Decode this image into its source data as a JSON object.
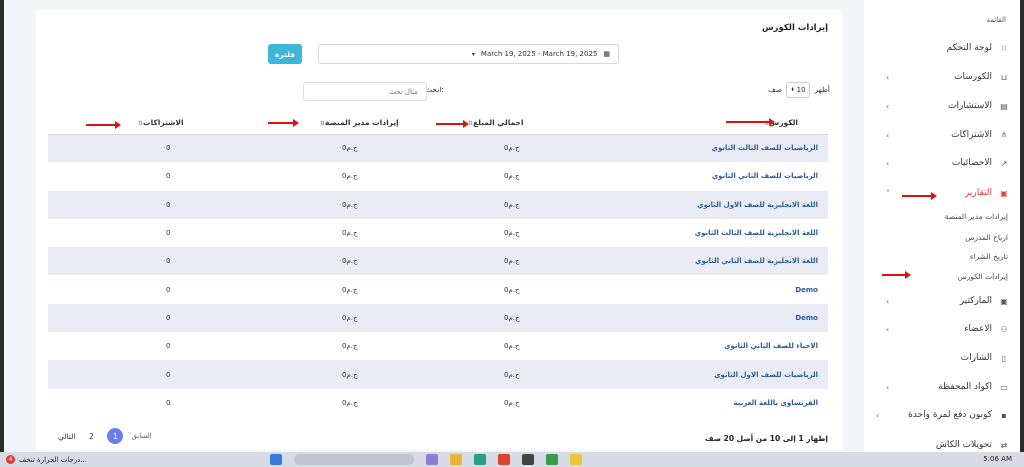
{
  "sidebar": {
    "heading": "القائمة",
    "items": [
      {
        "label": "لوحة التحكم",
        "icon": "grid-icon",
        "chevron": false
      },
      {
        "label": "الكورسات",
        "icon": "basket-icon",
        "chevron": true
      },
      {
        "label": "الاستشارات",
        "icon": "document-icon",
        "chevron": true
      },
      {
        "label": "الاشتراكات",
        "icon": "hierarchy-icon",
        "chevron": true
      },
      {
        "label": "الاحصائيات",
        "icon": "trend-icon",
        "chevron": true
      },
      {
        "label": "التقارير",
        "icon": "archive-icon",
        "chevron": true
      },
      {
        "label": "الماركتير",
        "icon": "archive-icon",
        "chevron": true
      },
      {
        "label": "الاعضاء",
        "icon": "users-icon",
        "chevron": true
      },
      {
        "label": "الشارات",
        "icon": "phone-icon",
        "chevron": false
      },
      {
        "label": "اكواد المحفظة",
        "icon": "wallet-icon",
        "chevron": true
      },
      {
        "label": "كوبون دفع لمرة واحدة",
        "icon": "coupon-icon",
        "chevron": true
      },
      {
        "label": "تحويلات الكاش",
        "icon": "transfer-icon",
        "chevron": false
      }
    ],
    "reports_sub": [
      "إيرادات مدير المنصة",
      "ارباح المدرس",
      "تاريخ الشراء",
      "إيرادات الكورس"
    ]
  },
  "card": {
    "title": "إيرادات الكورس",
    "date_range": "March 19, 2025 - March 19, 2025",
    "filter_label": "فلترة",
    "show_label": "أظهر",
    "page_size": "10",
    "rows_label": "صف",
    "search_label": "ابحث:",
    "search_placeholder": "مثال بحث"
  },
  "table": {
    "headers": {
      "course": "الكورس",
      "total": "اجمالي المبلغ",
      "platform": "إيرادات مدير المنصة",
      "subs": "الاشتراكات"
    },
    "rows": [
      {
        "course": "الرياضيات للصف الثالث الثانوي",
        "total": "0ج.م",
        "platform": "0ج.م",
        "subs": "0"
      },
      {
        "course": "الرياضيات للصف الثاني الثانوي",
        "total": "0ج.م",
        "platform": "0ج.م",
        "subs": "0"
      },
      {
        "course": "اللغة الانجليزية للصف الاول الثانوي",
        "total": "0ج.م",
        "platform": "0ج.م",
        "subs": "0"
      },
      {
        "course": "اللغة الانجليزية للصف الثالث الثانوي",
        "total": "0ج.م",
        "platform": "0ج.م",
        "subs": "0"
      },
      {
        "course": "اللغة الانجليزية للصف الثاني الثانوي",
        "total": "0ج.م",
        "platform": "0ج.م",
        "subs": "0"
      },
      {
        "course": "Demo",
        "total": "0ج.م",
        "platform": "0ج.م",
        "subs": "0"
      },
      {
        "course": "Demo",
        "total": "0ج.م",
        "platform": "0ج.م",
        "subs": "0"
      },
      {
        "course": "الاحياء للصف الثاني الثانوي",
        "total": "0ج.م",
        "platform": "0ج.م",
        "subs": "0"
      },
      {
        "course": "الرياضيات للصف الاول الثانوي",
        "total": "0ج.م",
        "platform": "0ج.م",
        "subs": "0"
      },
      {
        "course": "الفرنساوي باللغة العربية",
        "total": "0ج.م",
        "platform": "0ج.م",
        "subs": "0"
      }
    ]
  },
  "footer": {
    "info": "إظهار 1 إلى 10 من أصل 20 صف",
    "prev": "السابق",
    "pages": [
      "1",
      "2"
    ],
    "next": "التالي"
  },
  "taskbar": {
    "left_text": "درجات الحرارة تنخف...",
    "badge": "4",
    "time": "5:06 AM"
  }
}
